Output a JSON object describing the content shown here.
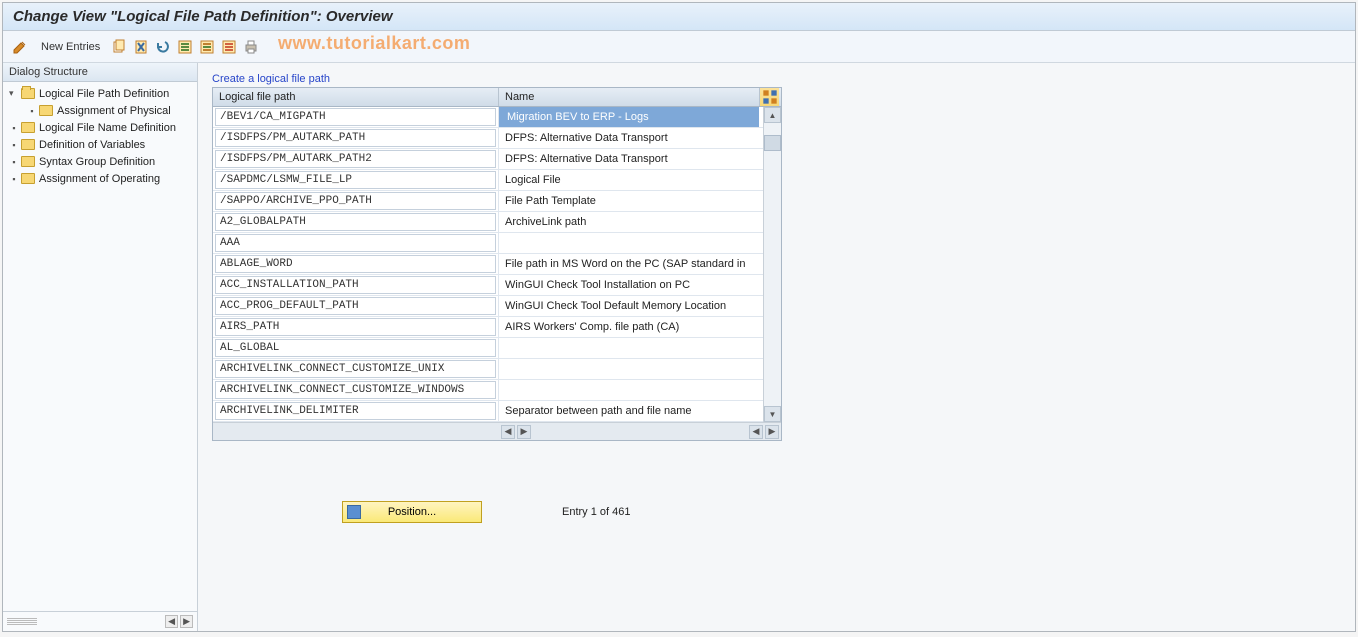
{
  "title": "Change View \"Logical File Path Definition\": Overview",
  "toolbar": {
    "new_entries_label": "New Entries"
  },
  "watermark": "www.tutorialkart.com",
  "sidebar": {
    "header": "Dialog Structure",
    "items": [
      {
        "label": "Logical File Path Definition",
        "level": 0,
        "open": true,
        "expanded": true
      },
      {
        "label": "Assignment of Physical",
        "level": 1,
        "open": false,
        "expanded": false
      },
      {
        "label": "Logical File Name Definition",
        "level": 0,
        "open": false,
        "expanded": false
      },
      {
        "label": "Definition of Variables",
        "level": 0,
        "open": false,
        "expanded": false
      },
      {
        "label": "Syntax Group Definition",
        "level": 0,
        "open": false,
        "expanded": false
      },
      {
        "label": "Assignment of Operating",
        "level": 0,
        "open": false,
        "expanded": false
      }
    ]
  },
  "main": {
    "create_link": "Create a logical file path",
    "columns": {
      "col1": "Logical file path",
      "col2": "Name"
    },
    "rows": [
      {
        "path": "/BEV1/CA_MIGPATH",
        "name": "Migration BEV to ERP - Logs",
        "selected": true
      },
      {
        "path": "/ISDFPS/PM_AUTARK_PATH",
        "name": "DFPS: Alternative Data Transport",
        "selected": false
      },
      {
        "path": "/ISDFPS/PM_AUTARK_PATH2",
        "name": "DFPS: Alternative Data Transport",
        "selected": false
      },
      {
        "path": "/SAPDMC/LSMW_FILE_LP",
        "name": "Logical File",
        "selected": false
      },
      {
        "path": "/SAPPO/ARCHIVE_PPO_PATH",
        "name": "File Path Template",
        "selected": false
      },
      {
        "path": "A2_GLOBALPATH",
        "name": "ArchiveLink path",
        "selected": false
      },
      {
        "path": "AAA",
        "name": "",
        "selected": false
      },
      {
        "path": "ABLAGE_WORD",
        "name": "File path in MS Word on the PC (SAP standard in",
        "selected": false
      },
      {
        "path": "ACC_INSTALLATION_PATH",
        "name": "WinGUI Check Tool Installation on PC",
        "selected": false
      },
      {
        "path": "ACC_PROG_DEFAULT_PATH",
        "name": "WinGUI Check Tool Default Memory Location",
        "selected": false
      },
      {
        "path": "AIRS_PATH",
        "name": "AIRS Workers' Comp. file path (CA)",
        "selected": false
      },
      {
        "path": "AL_GLOBAL",
        "name": "",
        "selected": false
      },
      {
        "path": "ARCHIVELINK_CONNECT_CUSTOMIZE_UNIX",
        "name": "",
        "selected": false
      },
      {
        "path": "ARCHIVELINK_CONNECT_CUSTOMIZE_WINDOWS",
        "name": "",
        "selected": false
      },
      {
        "path": "ARCHIVELINK_DELIMITER",
        "name": "Separator between path and file name",
        "selected": false
      }
    ],
    "position_label": "Position...",
    "entry_info": "Entry 1 of 461"
  }
}
